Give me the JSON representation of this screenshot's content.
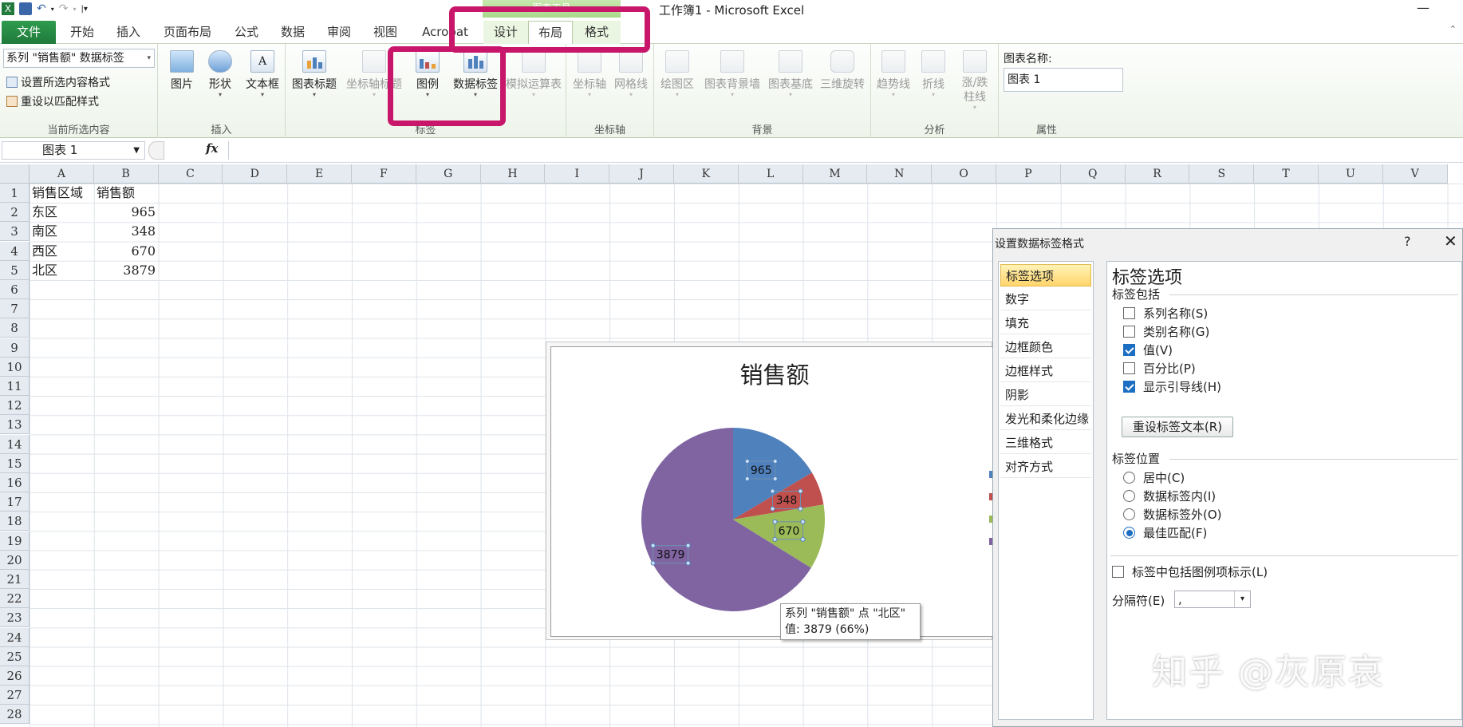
{
  "window": {
    "title": "工作簿1 - Microsoft Excel",
    "context_header": "图表工具",
    "minimize": "—"
  },
  "tabs": [
    "文件",
    "开始",
    "插入",
    "页面布局",
    "公式",
    "数据",
    "审阅",
    "视图",
    "Acrobat",
    "设计",
    "布局",
    "格式"
  ],
  "active_tab": "布局",
  "ribbon": {
    "current_selection": {
      "combo_value": "系列 \"销售额\" 数据标签",
      "format_selection": "设置所选内容格式",
      "reset_style": "重设以匹配样式",
      "group_label": "当前所选内容"
    },
    "insert": {
      "picture": "图片",
      "shapes": "形状",
      "textbox": "文本框",
      "group_label": "插入"
    },
    "labels": {
      "chart_title": "图表标题",
      "axis_titles": "坐标轴标题",
      "legend": "图例",
      "data_labels": "数据标签",
      "data_table": "模拟运算表",
      "group_label": "标签"
    },
    "axes": {
      "axes": "坐标轴",
      "gridlines": "网格线",
      "group_label": "坐标轴"
    },
    "background": {
      "plot_area": "绘图区",
      "chart_wall": "图表背景墙",
      "chart_floor": "图表基底",
      "rotation_3d": "三维旋转",
      "group_label": "背景"
    },
    "analysis": {
      "trendline": "趋势线",
      "lines": "折线",
      "updown_bars": "涨/跌柱线",
      "group_label": "分析"
    },
    "properties": {
      "chart_name_label": "图表名称:",
      "chart_name_value": "图表 1",
      "group_label": "属性"
    }
  },
  "formula_bar": {
    "name_box": "图表 1",
    "fx": "fx",
    "formula": ""
  },
  "columns": [
    "A",
    "B",
    "C",
    "D",
    "E",
    "F",
    "G",
    "H",
    "I",
    "J",
    "K",
    "L",
    "M",
    "N",
    "O",
    "P",
    "Q",
    "R",
    "S",
    "T",
    "U",
    "V"
  ],
  "rows": [
    "1",
    "2",
    "3",
    "4",
    "5",
    "6",
    "7",
    "8",
    "9",
    "10",
    "11",
    "12",
    "13",
    "14",
    "15",
    "16",
    "17",
    "18",
    "19",
    "20",
    "21",
    "22",
    "23",
    "24",
    "25",
    "26",
    "27",
    "28"
  ],
  "sheet": {
    "headers": [
      "销售区域",
      "销售额"
    ],
    "rows": [
      {
        "region": "东区",
        "sales": "965"
      },
      {
        "region": "南区",
        "sales": "348"
      },
      {
        "region": "西区",
        "sales": "670"
      },
      {
        "region": "北区",
        "sales": "3879"
      }
    ]
  },
  "chart_data": {
    "type": "pie",
    "title": "销售额",
    "categories": [
      "东区",
      "南区",
      "西区",
      "北区"
    ],
    "values": [
      965,
      348,
      670,
      3879
    ],
    "data_labels": [
      "965",
      "348",
      "670",
      "3879"
    ],
    "colors": [
      "#4f81bd",
      "#c0504d",
      "#9bbb59",
      "#8064a2"
    ],
    "legend": "right"
  },
  "tooltip": {
    "line1": "系列 \"销售额\" 点 \"北区\"",
    "line2": "值: 3879 (66%)"
  },
  "dialog": {
    "title": "设置数据标签格式",
    "help": "?",
    "close": "✕",
    "nav": [
      "标签选项",
      "数字",
      "填充",
      "边框颜色",
      "边框样式",
      "阴影",
      "发光和柔化边缘",
      "三维格式",
      "对齐方式"
    ],
    "panel_title": "标签选项",
    "contains_label": "标签包括",
    "checkboxes": [
      {
        "label": "系列名称(S)",
        "checked": false
      },
      {
        "label": "类别名称(G)",
        "checked": false
      },
      {
        "label": "值(V)",
        "checked": true
      },
      {
        "label": "百分比(P)",
        "checked": false
      },
      {
        "label": "显示引导线(H)",
        "checked": true
      }
    ],
    "reset_button": "重设标签文本(R)",
    "position_label": "标签位置",
    "radios": [
      {
        "label": "居中(C)",
        "checked": false
      },
      {
        "label": "数据标签内(I)",
        "checked": false
      },
      {
        "label": "数据标签外(O)",
        "checked": false
      },
      {
        "label": "最佳匹配(F)",
        "checked": true
      }
    ],
    "legend_key": {
      "label": "标签中包括图例项标示(L)",
      "checked": false
    },
    "separator_label": "分隔符(E)",
    "separator_value": ","
  },
  "watermark": "知乎 @灰原哀"
}
